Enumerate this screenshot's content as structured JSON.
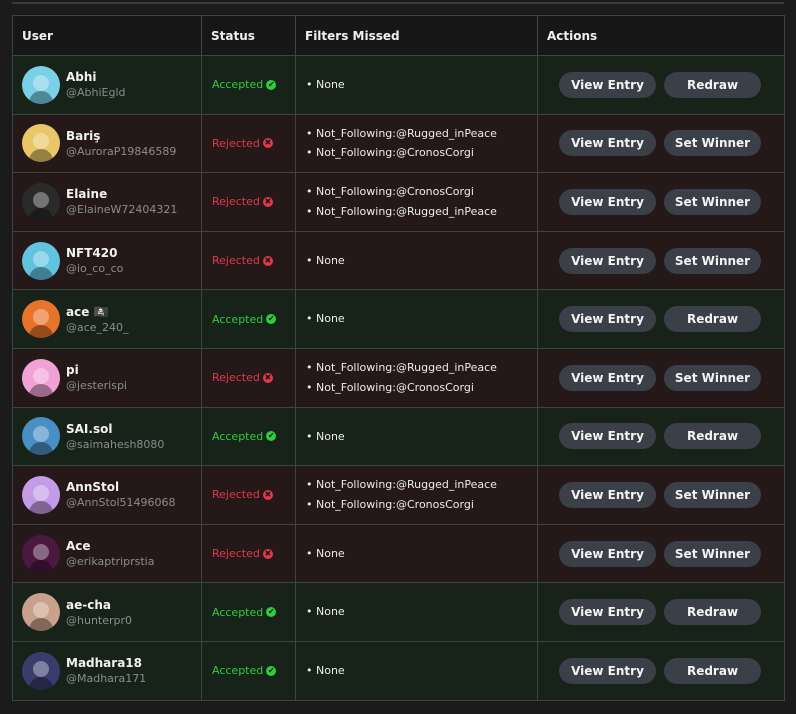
{
  "headers": {
    "user": "User",
    "status": "Status",
    "filters": "Filters Missed",
    "actions": "Actions"
  },
  "status_colors": {
    "Accepted": "#2ecc40",
    "Rejected": "#e0394a"
  },
  "status_icons": {
    "Accepted": "✔",
    "Rejected": "✖"
  },
  "buttons": {
    "view": "View Entry",
    "redraw": "Redraw",
    "set_winner": "Set Winner"
  },
  "rows": [
    {
      "name": "Abhi",
      "handle": "@AbhiEgld",
      "avatar_color": "#7ad0e6",
      "status": "Accepted",
      "filters": [
        "None"
      ],
      "action": "Redraw"
    },
    {
      "name": "Bariş",
      "handle": "@AuroraP19846589",
      "avatar_color": "#e9c766",
      "status": "Rejected",
      "filters": [
        "Not_Following:@Rugged_inPeace",
        "Not_Following:@CronosCorgi"
      ],
      "action": "Set Winner"
    },
    {
      "name": "Elaine",
      "handle": "@ElaineW72404321",
      "avatar_color": "#2a2a2a",
      "status": "Rejected",
      "filters": [
        "Not_Following:@CronosCorgi",
        "Not_Following:@Rugged_inPeace"
      ],
      "action": "Set Winner"
    },
    {
      "name": "NFT420",
      "handle": "@io_co_co",
      "avatar_color": "#62c3df",
      "status": "Rejected",
      "filters": [
        "None"
      ],
      "action": "Set Winner"
    },
    {
      "name": "ace 🏴‍☠️",
      "handle": "@ace_240_",
      "avatar_color": "#e8742a",
      "status": "Accepted",
      "filters": [
        "None"
      ],
      "action": "Redraw"
    },
    {
      "name": "pi",
      "handle": "@jesterispi",
      "avatar_color": "#f2a1d6",
      "status": "Rejected",
      "filters": [
        "Not_Following:@Rugged_inPeace",
        "Not_Following:@CronosCorgi"
      ],
      "action": "Set Winner"
    },
    {
      "name": "SAI.sol",
      "handle": "@saimahesh8080",
      "avatar_color": "#4a8fc4",
      "status": "Accepted",
      "filters": [
        "None"
      ],
      "action": "Redraw"
    },
    {
      "name": "AnnStol",
      "handle": "@AnnStol51496068",
      "avatar_color": "#c49be6",
      "status": "Rejected",
      "filters": [
        "Not_Following:@Rugged_inPeace",
        "Not_Following:@CronosCorgi"
      ],
      "action": "Set Winner"
    },
    {
      "name": "Ace",
      "handle": "@erikaptriprstia",
      "avatar_color": "#4a1840",
      "status": "Rejected",
      "filters": [
        "None"
      ],
      "action": "Set Winner"
    },
    {
      "name": "ae-cha",
      "handle": "@hunterpr0",
      "avatar_color": "#c9a08a",
      "status": "Accepted",
      "filters": [
        "None"
      ],
      "action": "Redraw"
    },
    {
      "name": "Madhara18",
      "handle": "@Madhara171",
      "avatar_color": "#3a3c6e",
      "status": "Accepted",
      "filters": [
        "None"
      ],
      "action": "Redraw"
    }
  ]
}
